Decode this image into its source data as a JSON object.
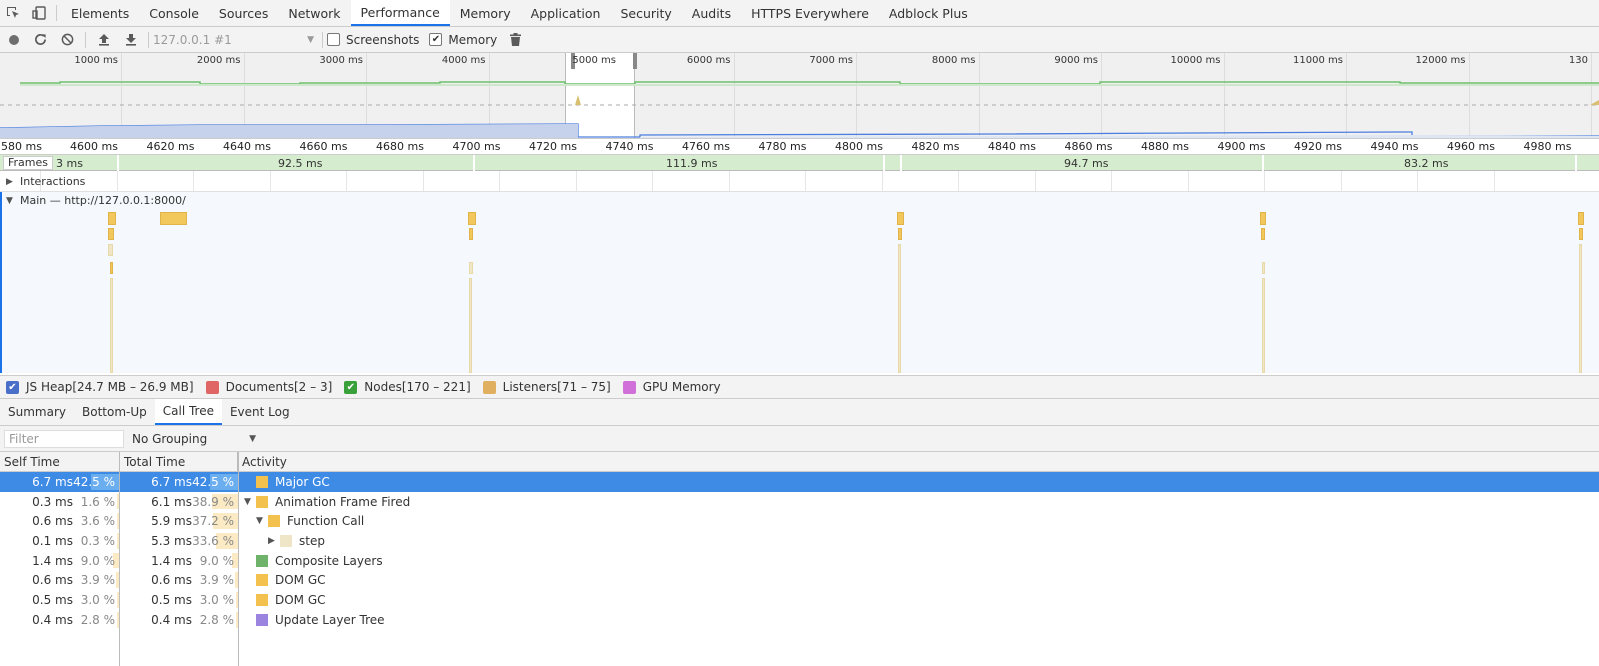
{
  "main_tabs": [
    "Elements",
    "Console",
    "Sources",
    "Network",
    "Performance",
    "Memory",
    "Application",
    "Security",
    "Audits",
    "HTTPS Everywhere",
    "Adblock Plus"
  ],
  "active_main_tab": "Performance",
  "toolbar": {
    "session": "127.0.0.1 #1",
    "screenshots_label": "Screenshots",
    "screenshots_checked": false,
    "memory_label": "Memory",
    "memory_checked": true
  },
  "overview": {
    "labels": [
      "1000 ms",
      "2000 ms",
      "3000 ms",
      "4000 ms",
      "5000 ms",
      "6000 ms",
      "7000 ms",
      "8000 ms",
      "9000 ms",
      "10000 ms",
      "11000 ms",
      "12000 ms",
      "130"
    ]
  },
  "ruler": {
    "labels": [
      "580 ms",
      "4600 ms",
      "4620 ms",
      "4640 ms",
      "4660 ms",
      "4680 ms",
      "4700 ms",
      "4720 ms",
      "4740 ms",
      "4760 ms",
      "4780 ms",
      "4800 ms",
      "4820 ms",
      "4840 ms",
      "4860 ms",
      "4880 ms",
      "4900 ms",
      "4920 ms",
      "4940 ms",
      "4960 ms",
      "4980 ms"
    ]
  },
  "frames": {
    "label": "Frames",
    "durations": [
      "3 ms",
      "92.5 ms",
      "111.9 ms",
      "94.7 ms",
      "83.2 ms"
    ]
  },
  "tracks": {
    "interactions": "Interactions",
    "main": "Main — http://127.0.0.1:8000/"
  },
  "legend": [
    {
      "label": "JS Heap[24.7 MB – 26.9 MB]",
      "color": "#4a6fc8",
      "checked": true
    },
    {
      "label": "Documents[2 – 3]",
      "color": "#e06666",
      "checked": false
    },
    {
      "label": "Nodes[170 – 221]",
      "color": "#3aa03a",
      "checked": true
    },
    {
      "label": "Listeners[71 – 75]",
      "color": "#e0b060",
      "checked": false
    },
    {
      "label": "GPU Memory",
      "color": "#d070d8",
      "checked": false
    }
  ],
  "bottom_tabs": [
    "Summary",
    "Bottom-Up",
    "Call Tree",
    "Event Log"
  ],
  "active_bottom_tab": "Call Tree",
  "filter": {
    "placeholder": "Filter",
    "grouping": "No Grouping"
  },
  "table": {
    "headers": {
      "self": "Self Time",
      "total": "Total Time",
      "activity": "Activity"
    },
    "rows": [
      {
        "self_ms": "6.7 ms",
        "self_pct": "42.5 %",
        "self_frac": 0.425,
        "total_ms": "6.7 ms",
        "total_pct": "42.5 %",
        "total_frac": 0.425,
        "activity": "Major GC",
        "color": "#f2c14e",
        "depth": 0,
        "toggle": "",
        "selected": true
      },
      {
        "self_ms": "0.3 ms",
        "self_pct": "1.6 %",
        "self_frac": 0.016,
        "total_ms": "6.1 ms",
        "total_pct": "38.9 %",
        "total_frac": 0.389,
        "activity": "Animation Frame Fired",
        "color": "#f2c14e",
        "depth": 0,
        "toggle": "▼",
        "selected": false
      },
      {
        "self_ms": "0.6 ms",
        "self_pct": "3.6 %",
        "self_frac": 0.036,
        "total_ms": "5.9 ms",
        "total_pct": "37.2 %",
        "total_frac": 0.372,
        "activity": "Function Call",
        "color": "#f2c14e",
        "depth": 1,
        "toggle": "▼",
        "selected": false
      },
      {
        "self_ms": "0.1 ms",
        "self_pct": "0.3 %",
        "self_frac": 0.003,
        "total_ms": "5.3 ms",
        "total_pct": "33.6 %",
        "total_frac": 0.336,
        "activity": "step",
        "color": "#efe6c8",
        "depth": 2,
        "toggle": "▶",
        "selected": false
      },
      {
        "self_ms": "1.4 ms",
        "self_pct": "9.0 %",
        "self_frac": 0.09,
        "total_ms": "1.4 ms",
        "total_pct": "9.0 %",
        "total_frac": 0.09,
        "activity": "Composite Layers",
        "color": "#6fb36a",
        "depth": 0,
        "toggle": "",
        "selected": false
      },
      {
        "self_ms": "0.6 ms",
        "self_pct": "3.9 %",
        "self_frac": 0.039,
        "total_ms": "0.6 ms",
        "total_pct": "3.9 %",
        "total_frac": 0.039,
        "activity": "DOM GC",
        "color": "#f2c14e",
        "depth": 0,
        "toggle": "",
        "selected": false
      },
      {
        "self_ms": "0.5 ms",
        "self_pct": "3.0 %",
        "self_frac": 0.03,
        "total_ms": "0.5 ms",
        "total_pct": "3.0 %",
        "total_frac": 0.03,
        "activity": "DOM GC",
        "color": "#f2c14e",
        "depth": 0,
        "toggle": "",
        "selected": false
      },
      {
        "self_ms": "0.4 ms",
        "self_pct": "2.8 %",
        "self_frac": 0.028,
        "total_ms": "0.4 ms",
        "total_pct": "2.8 %",
        "total_frac": 0.028,
        "activity": "Update Layer Tree",
        "color": "#9b83e0",
        "depth": 0,
        "toggle": "",
        "selected": false
      }
    ]
  }
}
